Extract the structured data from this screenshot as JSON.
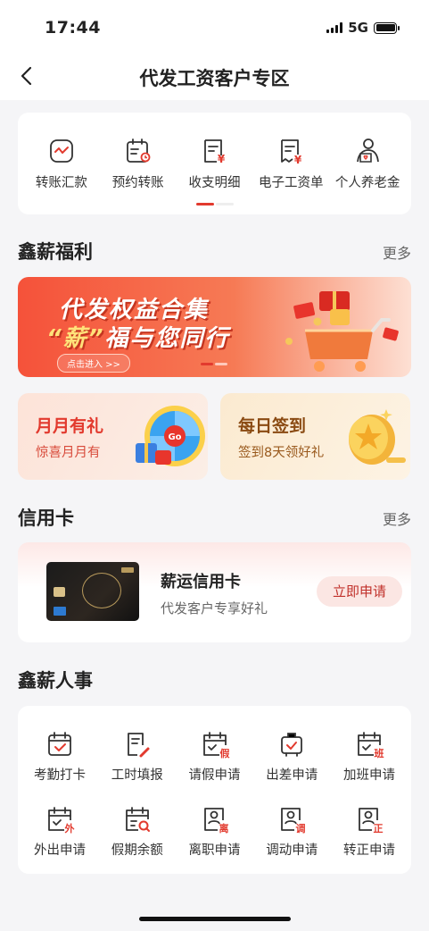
{
  "status": {
    "time": "17:44",
    "network": "5G"
  },
  "nav": {
    "title": "代发工资客户专区"
  },
  "quick_menu": [
    {
      "label": "转账汇款",
      "icon": "transfer-icon"
    },
    {
      "label": "预约转账",
      "icon": "scheduled-transfer-icon"
    },
    {
      "label": "收支明细",
      "icon": "statement-icon"
    },
    {
      "label": "电子工资单",
      "icon": "payslip-icon"
    },
    {
      "label": "个人养老金",
      "icon": "pension-icon"
    }
  ],
  "welfare": {
    "title": "鑫薪福利",
    "more": "更多",
    "banner": {
      "line1": "代发权益合集",
      "line2_quote": "“薪”",
      "line2_rest": "福与您同行",
      "enter": "点击进入 >>"
    },
    "promos": [
      {
        "title": "月月有礼",
        "subtitle": "惊喜月月有"
      },
      {
        "title": "每日签到",
        "subtitle": "签到8天领好礼"
      }
    ]
  },
  "credit": {
    "title": "信用卡",
    "more": "更多",
    "card_name": "薪运信用卡",
    "card_desc": "代发客户专享好礼",
    "apply": "立即申请"
  },
  "hr": {
    "title": "鑫薪人事",
    "row1": [
      {
        "label": "考勤打卡",
        "icon": "attendance-icon",
        "tag": ""
      },
      {
        "label": "工时填报",
        "icon": "timesheet-icon",
        "tag": ""
      },
      {
        "label": "请假申请",
        "icon": "leave-icon",
        "tag": "假"
      },
      {
        "label": "出差申请",
        "icon": "business-trip-icon",
        "tag": ""
      },
      {
        "label": "加班申请",
        "icon": "overtime-icon",
        "tag": "班"
      }
    ],
    "row2": [
      {
        "label": "外出申请",
        "icon": "outing-icon",
        "tag": "外"
      },
      {
        "label": "假期余额",
        "icon": "leave-balance-icon",
        "tag": ""
      },
      {
        "label": "离职申请",
        "icon": "resignation-icon",
        "tag": "离"
      },
      {
        "label": "调动申请",
        "icon": "transfer-post-icon",
        "tag": "调"
      },
      {
        "label": "转正申请",
        "icon": "regularization-icon",
        "tag": "正"
      }
    ]
  },
  "colors": {
    "accent": "#e23a2e",
    "icon_stroke": "#333333"
  }
}
